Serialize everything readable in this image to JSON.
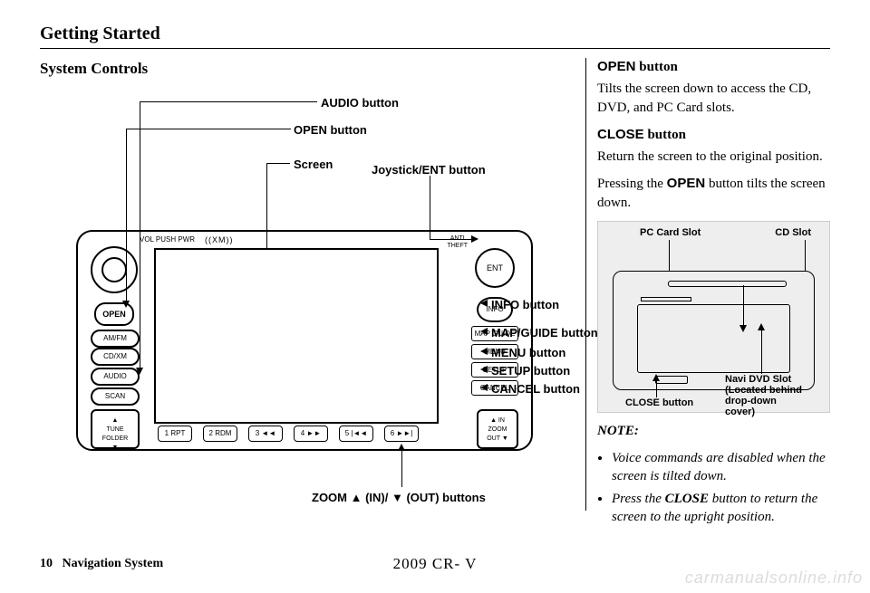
{
  "header": "Getting Started",
  "section": "System Controls",
  "labels": {
    "audio": "AUDIO button",
    "open": "OPEN button",
    "screen": "Screen",
    "joystick": "Joystick/ENT button",
    "info": "INFO button",
    "mapguide": "MAP/GUIDE button",
    "menu": "MENU button",
    "setup": "SETUP button",
    "cancel": "CANCEL button",
    "zoom": "ZOOM ▲ (IN)/ ▼  (OUT) buttons"
  },
  "unit": {
    "volpwr": "VOL PUSH PWR",
    "xm": "((XM))",
    "anti": "ANTI\nTHEFT",
    "open": "OPEN",
    "amfm": "AM/FM",
    "cdxm": "CD/XM",
    "audio": "AUDIO",
    "scan": "SCAN",
    "tune": "▲\nTUNE\nFOLDER\n▼",
    "ent": "ENT",
    "info": "INFO",
    "mapguide": "MAP GUIDE",
    "menu": "MENU",
    "setup": "SETUP",
    "cancel": "CANCEL",
    "zoom": "▲ IN\nZOOM\nOUT ▼",
    "presets": [
      "1 RPT",
      "2 RDM",
      "3 ◄◄",
      "4 ►►",
      "5 |◄◄",
      "6 ►►|"
    ]
  },
  "right": {
    "open_h": "OPEN",
    "open_h2": "button",
    "open_t": "Tilts the screen down to access the CD, DVD, and PC Card slots.",
    "close_h": "CLOSE",
    "close_h2": "button",
    "close_t": "Return the screen to the original position.",
    "press1": "Pressing the ",
    "press_b": "OPEN",
    "press2": " button tilts the screen down.",
    "fig": {
      "pc": "PC Card Slot",
      "cd": "CD Slot",
      "close": "CLOSE button",
      "navi": "Navi DVD Slot\n(Located behind\ndrop-down\ncover)"
    },
    "note_h": "NOTE:",
    "note1": "Voice commands are disabled when the screen is tilted down.",
    "note2a": "Press the ",
    "note2b": "CLOSE",
    "note2c": " button to return the screen to the upright position."
  },
  "footer": {
    "pg": "10",
    "sys": "Navigation System",
    "model": "2009  CR- V",
    "water": "carmanualsonline.info"
  }
}
